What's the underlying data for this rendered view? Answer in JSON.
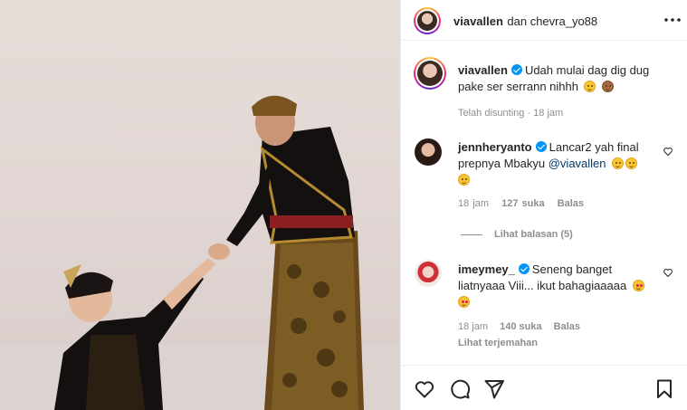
{
  "header": {
    "title_user": "viavallen",
    "title_rest": "dan chevra_yo88",
    "more_icon": "more-horizontal-icon"
  },
  "caption": {
    "username": "viavallen",
    "text_line1": "Udah mulai dag dig dug",
    "text_line2": "pake ser serrann nihhh",
    "emojis": [
      "winking-face",
      "see-no-evil-monkey"
    ],
    "edited": "Telah disunting",
    "time": "18 jam"
  },
  "comments": [
    {
      "username": "jennheryanto",
      "text_line1": "Lancar2 yah final",
      "text_line2_prefix": "prepnya Mbakyu ",
      "mention": "@viavallen",
      "emojis": [
        "hugging-face",
        "hugging-face",
        "hugging-face"
      ],
      "time": "18 jam",
      "likes": "127 suka",
      "reply": "Balas",
      "view_replies": "Lihat balasan (5)"
    },
    {
      "username": "imeymey_",
      "text_line1": "Seneng banget",
      "text_line2": "liatnyaaa Viii... ikut bahagiaaaaa",
      "emojis": [
        "heart-eyes",
        "heart-eyes"
      ],
      "time": "18 jam",
      "likes": "140 suka",
      "reply": "Balas",
      "translate": "Lihat terjemahan"
    }
  ],
  "actions": {
    "like_icon": "heart-icon",
    "comment_icon": "comment-icon",
    "share_icon": "send-icon",
    "save_icon": "bookmark-icon"
  },
  "colors": {
    "verified": "#0095f6",
    "text": "#262626",
    "muted": "#8e8e8e",
    "link": "#00376b"
  }
}
